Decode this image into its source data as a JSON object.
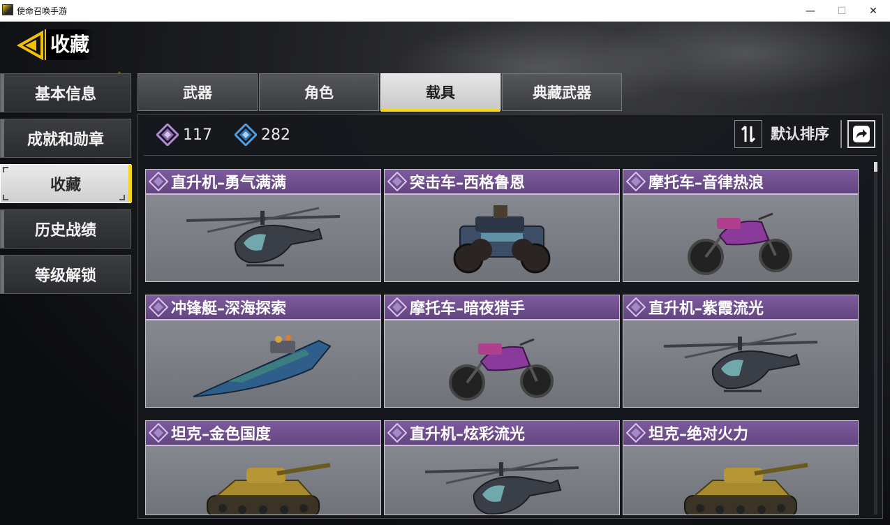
{
  "window": {
    "title": "使命召唤手游",
    "minimize_glyph": "—",
    "maximize_glyph": "☐",
    "close_glyph": "✕"
  },
  "header": {
    "title": "收藏"
  },
  "sidebar": {
    "items": [
      {
        "label": "基本信息",
        "active": false
      },
      {
        "label": "成就和勋章",
        "active": false
      },
      {
        "label": "收藏",
        "active": true
      },
      {
        "label": "历史战绩",
        "active": false
      },
      {
        "label": "等级解锁",
        "active": false
      }
    ]
  },
  "tabs": [
    {
      "label": "武器",
      "active": false
    },
    {
      "label": "角色",
      "active": false
    },
    {
      "label": "载具",
      "active": true
    },
    {
      "label": "典藏武器",
      "active": false
    }
  ],
  "stats": {
    "purple_count": "117",
    "blue_count": "282"
  },
  "sort": {
    "label": "默认排序"
  },
  "cards": [
    {
      "name": "直升机–勇气满满",
      "vehicle": "helicopter",
      "icon": "helicopter-icon"
    },
    {
      "name": "突击车–西格鲁恩",
      "vehicle": "assault-car",
      "icon": "assault-car-icon"
    },
    {
      "name": "摩托车–音律热浪",
      "vehicle": "motorcycle",
      "icon": "motorcycle-icon"
    },
    {
      "name": "冲锋艇–深海探索",
      "vehicle": "boat",
      "icon": "boat-icon"
    },
    {
      "name": "摩托车–暗夜猎手",
      "vehicle": "motorcycle",
      "icon": "motorcycle-icon"
    },
    {
      "name": "直升机–紫霞流光",
      "vehicle": "helicopter",
      "icon": "helicopter-icon"
    },
    {
      "name": "坦克–金色国度",
      "vehicle": "tank",
      "icon": "tank-icon"
    },
    {
      "name": "直升机–炫彩流光",
      "vehicle": "helicopter",
      "icon": "helicopter-icon"
    },
    {
      "name": "坦克–绝对火力",
      "vehicle": "tank",
      "icon": "tank-icon"
    }
  ],
  "colors": {
    "accent_yellow": "#f6d31c",
    "rarity_purple": "#7e5a9e",
    "rarity_icon_purple": "#b48ad8",
    "rarity_icon_blue": "#4f9fe0"
  }
}
